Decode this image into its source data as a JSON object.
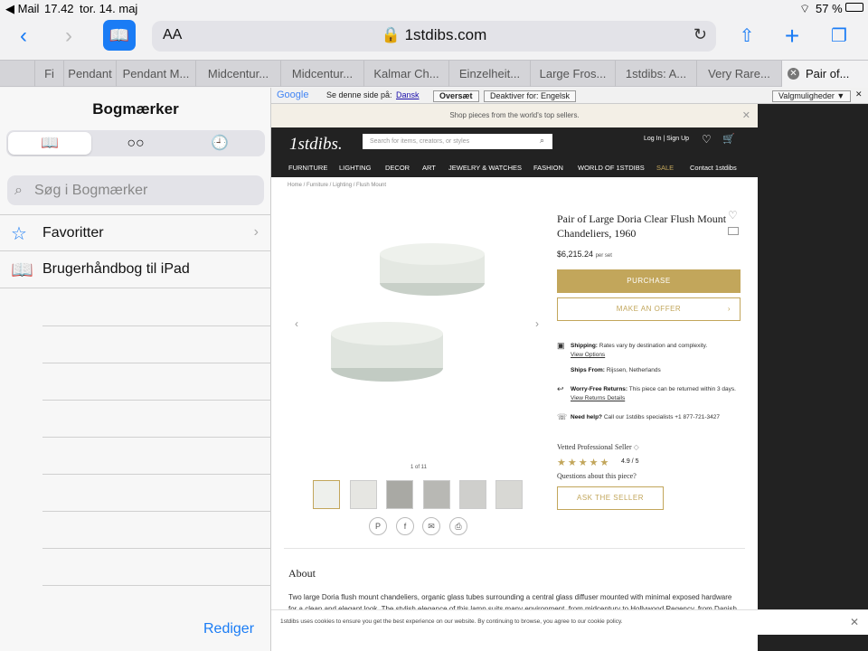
{
  "status": {
    "back_app": "◀ Mail",
    "time": "17.42",
    "date": "tor. 14. maj",
    "battery": "57 %"
  },
  "toolbar": {
    "text_size": "AA",
    "url": "1stdibs.com"
  },
  "tabs": [
    "Fi",
    "Pendant",
    "Pendant M...",
    "Midcentur...",
    "Midcentur...",
    "Kalmar Ch...",
    "Einzelheit...",
    "Large Fros...",
    "1stdibs: A...",
    "Very Rare...",
    "Pair of..."
  ],
  "sidebar": {
    "title": "Bogmærker",
    "search_placeholder": "Søg i Bogmærker",
    "items": [
      {
        "label": "Favoritter"
      },
      {
        "label": "Brugerhåndbog til iPad"
      }
    ],
    "edit": "Rediger"
  },
  "translate": {
    "prompt": "Se denne side på:",
    "lang": "Dansk",
    "btn_translated": "Oversæt",
    "btn_disable": "Deaktiver for: Engelsk",
    "options": "Valgmuligheder ▼"
  },
  "page": {
    "promo": "Shop pieces from the world's top sellers.",
    "logo": "1stdibs.",
    "search_placeholder": "Search for items, creators, or styles",
    "login": "Log In  |  Sign Up",
    "nav": [
      "FURNITURE",
      "LIGHTING",
      "DECOR",
      "ART",
      "JEWELRY & WATCHES",
      "FASHION",
      "WORLD OF 1STDIBS",
      "SALE",
      "Contact 1stdibs"
    ],
    "breadcrumb": "Home  /  Furniture  /  Lighting  /  Flush Mount",
    "image_counter": "1 of 11",
    "title": "Pair of Large Doria Clear Flush Mount Chandeliers, 1960",
    "price": "$6,215.24",
    "price_unit": "per set",
    "purchase": "PURCHASE",
    "offer": "MAKE AN OFFER",
    "shipping_label": "Shipping:",
    "shipping_text": "Rates vary by destination and complexity.",
    "shipping_link": "View Options",
    "ships_from_label": "Ships From:",
    "ships_from": "Rijssen, Netherlands",
    "returns_label": "Worry-Free Returns:",
    "returns_text": "This piece can be returned within 3 days.",
    "returns_link": "View Returns Details",
    "help_label": "Need help?",
    "help_text": "Call our 1stdibs specialists +1 877-721-3427",
    "vetted": "Vetted Professional Seller",
    "rating": "4.9 / 5",
    "questions": "Questions about this piece?",
    "ask": "ASK THE SELLER",
    "about": "About",
    "description": "Two large Doria flush mount chandeliers, organic glass tubes surrounding a central glass diffuser mounted with minimal exposed hardware for a clean and elegant look. The stylish elegance of this lamp suits many environment, from midcentury to Hollywood Regency, from Danish modern to Space Age and contemporary interior.",
    "cookie": "1stdibs uses cookies to ensure you get the best experience on our website. By continuing to browse, you agree to our cookie policy."
  }
}
